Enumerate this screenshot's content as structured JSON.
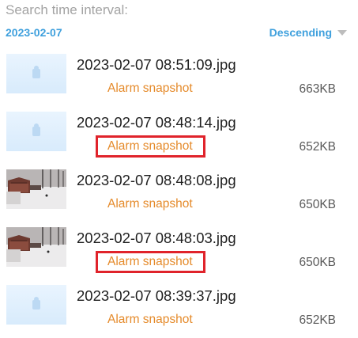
{
  "header": {
    "label": "Search time interval:",
    "date": "2023-02-07",
    "sort_label": "Descending"
  },
  "files": [
    {
      "name": "2023-02-07 08:51:09.jpg",
      "tag": "Alarm snapshot",
      "size": "663KB",
      "thumb": "blank",
      "highlighted": false
    },
    {
      "name": "2023-02-07 08:48:14.jpg",
      "tag": "Alarm snapshot",
      "size": "652KB",
      "thumb": "blank",
      "highlighted": true
    },
    {
      "name": "2023-02-07 08:48:08.jpg",
      "tag": "Alarm snapshot",
      "size": "650KB",
      "thumb": "photo",
      "highlighted": false
    },
    {
      "name": "2023-02-07 08:48:03.jpg",
      "tag": "Alarm snapshot",
      "size": "650KB",
      "thumb": "photo",
      "highlighted": true
    },
    {
      "name": "2023-02-07 08:39:37.jpg",
      "tag": "Alarm snapshot",
      "size": "652KB",
      "thumb": "blank",
      "highlighted": false
    }
  ],
  "colors": {
    "accent": "#3fa0dd",
    "tag": "#e58a2a",
    "highlight_box": "#e0232b"
  },
  "icons": {
    "sort": "caret-down-icon",
    "placeholder": "image-placeholder-icon"
  }
}
